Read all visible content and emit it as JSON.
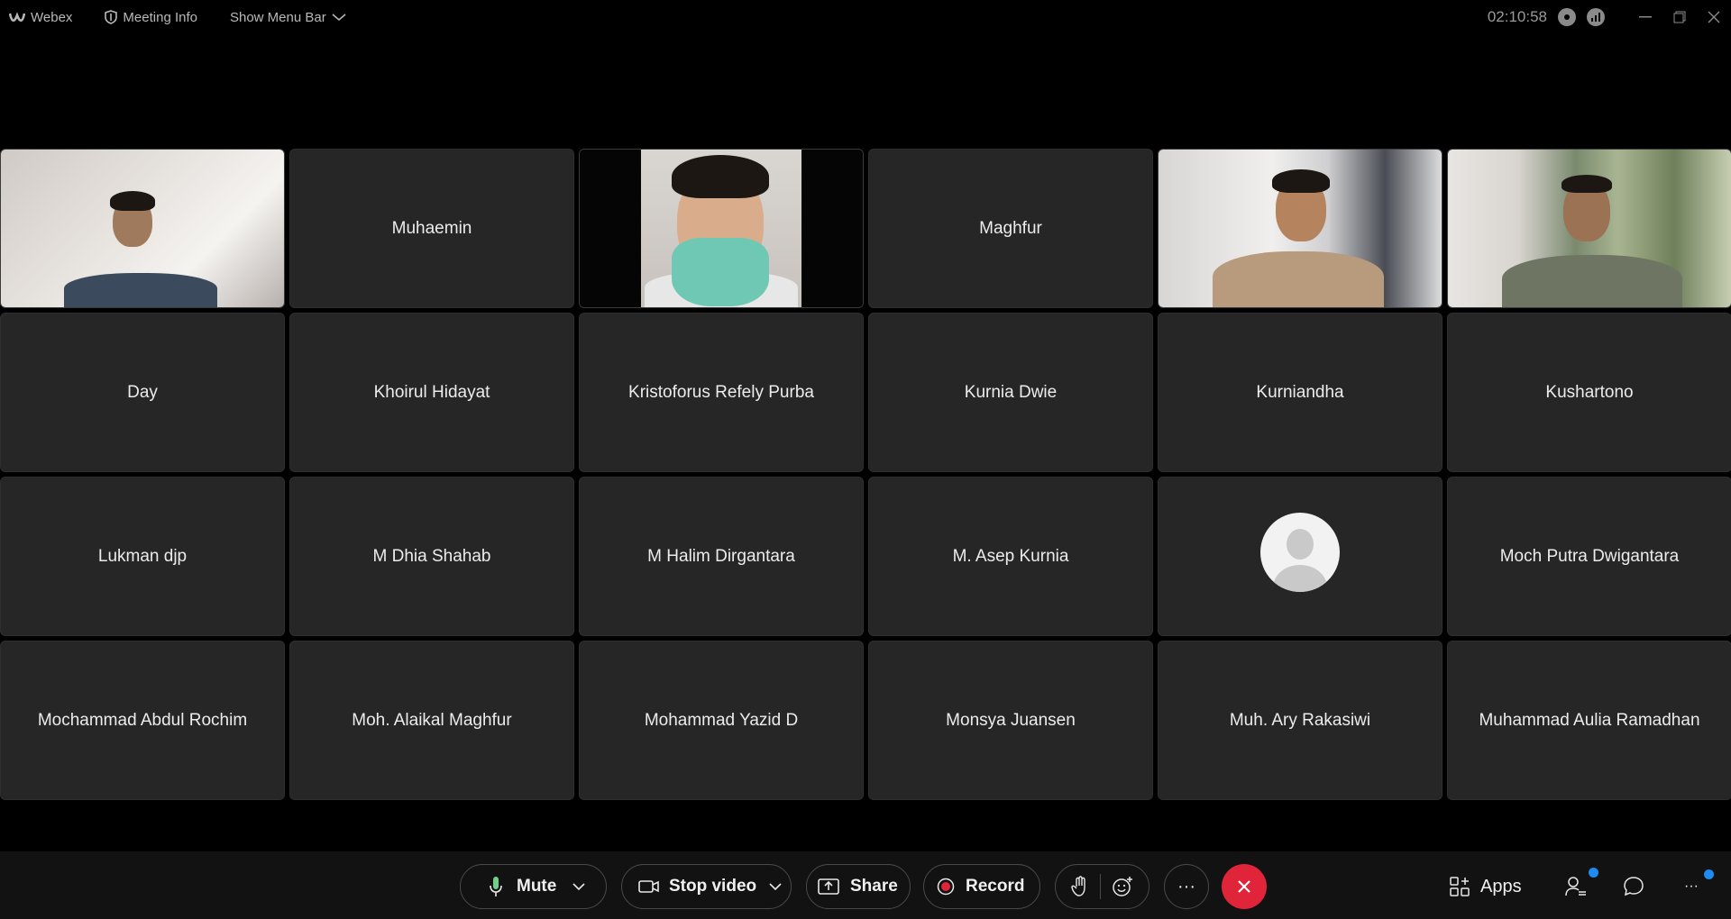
{
  "titlebar": {
    "app_name": "Webex",
    "meeting_info": "Meeting Info",
    "show_menu_bar": "Show Menu Bar",
    "clock": "02:10:58"
  },
  "tiles": [
    {
      "type": "video",
      "name": ""
    },
    {
      "type": "name",
      "name": "Muhaemin"
    },
    {
      "type": "video",
      "name": ""
    },
    {
      "type": "name",
      "name": "Maghfur"
    },
    {
      "type": "video",
      "name": ""
    },
    {
      "type": "video",
      "name": ""
    },
    {
      "type": "name",
      "name": "Day"
    },
    {
      "type": "name",
      "name": "Khoirul Hidayat"
    },
    {
      "type": "name",
      "name": "Kristoforus Refely Purba"
    },
    {
      "type": "name",
      "name": "Kurnia Dwie"
    },
    {
      "type": "name",
      "name": "Kurniandha"
    },
    {
      "type": "name",
      "name": "Kushartono"
    },
    {
      "type": "name",
      "name": "Lukman djp"
    },
    {
      "type": "name",
      "name": "M Dhia Shahab"
    },
    {
      "type": "name",
      "name": "M Halim Dirgantara"
    },
    {
      "type": "name",
      "name": "M. Asep Kurnia"
    },
    {
      "type": "avatar",
      "name": ""
    },
    {
      "type": "name",
      "name": "Moch Putra Dwigantara"
    },
    {
      "type": "name",
      "name": "Mochammad Abdul Rochim"
    },
    {
      "type": "name",
      "name": "Moh. Alaikal Maghfur"
    },
    {
      "type": "name",
      "name": "Mohammad Yazid D"
    },
    {
      "type": "name",
      "name": "Monsya Juansen"
    },
    {
      "type": "name",
      "name": "Muh. Ary Rakasiwi"
    },
    {
      "type": "name",
      "name": "Muhammad Aulia Ramadhan"
    }
  ],
  "toolbar": {
    "mute_label": "Mute",
    "stop_video_label": "Stop video",
    "share_label": "Share",
    "record_label": "Record",
    "more_label": "···",
    "apps_label": "Apps",
    "side_more_label": "···"
  },
  "colors": {
    "end_call": "#e0243a",
    "notification_dot": "#1d8bf0",
    "record_dot": "#e0243a"
  }
}
